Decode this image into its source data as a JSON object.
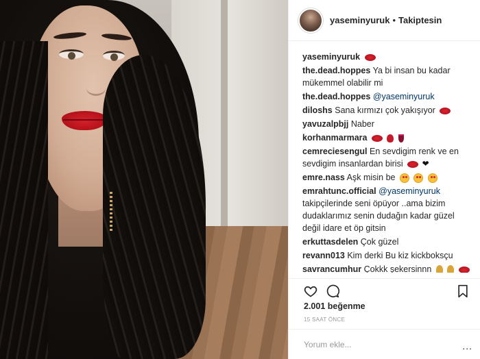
{
  "post": {
    "username": "yaseminyuruk",
    "separator": "•",
    "follow_status": "Takiptesin"
  },
  "comments": [
    {
      "user": "yaseminyuruk",
      "text": "",
      "emojis": [
        "kiss-lips"
      ]
    },
    {
      "user": "the.dead.hoppes",
      "text": "Ya bi insan bu kadar mükemmel olabilir mi",
      "emojis": []
    },
    {
      "user": "the.dead.hoppes",
      "text": "@yaseminyuruk",
      "emojis": []
    },
    {
      "user": "diloshs",
      "text": "Sana kırmızı çok yakışıyor",
      "emojis": [
        "kiss-lips"
      ]
    },
    {
      "user": "yavuzalpbjj",
      "text": "Naber",
      "emojis": []
    },
    {
      "user": "korhanmarmara",
      "text": "",
      "emojis": [
        "kiss-lips",
        "rose",
        "wine-glass"
      ]
    },
    {
      "user": "cemreciesengul",
      "text": "En sevdigim renk ve en sevdigim insanlardan birisi",
      "emojis": [
        "kiss-lips",
        "black-heart"
      ]
    },
    {
      "user": "emre.nass",
      "text": "Aşk misin be",
      "emojis": [
        "heart-eyes-face",
        "heart-eyes-face",
        "heart-eyes-face"
      ]
    },
    {
      "user": "emrahtunc.official",
      "text": "@yaseminyuruk",
      "text2": "takipçilerinde seni öpüyor ..ama bizim dudaklarımız senin dudağın kadar güzel değil idare et öp gitsin",
      "emojis": []
    },
    {
      "user": "erkuttasdelen",
      "text": "Çok güzel",
      "emojis": []
    },
    {
      "user": "revann013",
      "text": "Kim derki Bu kiz kickboksçu",
      "emojis": []
    },
    {
      "user": "savrancumhur",
      "text": "Çokkk şekersinnn",
      "emojis": [
        "gold",
        "gold",
        "kiss-lips"
      ]
    }
  ],
  "actions": {
    "like_icon": "heart-outline",
    "comment_icon": "comment-bubble",
    "save_icon": "bookmark"
  },
  "likes_text": "2.001 beğenme",
  "time_text": "15 SAAT ÖNCE",
  "add_comment": {
    "placeholder": "Yorum ekle...",
    "more": "..."
  }
}
